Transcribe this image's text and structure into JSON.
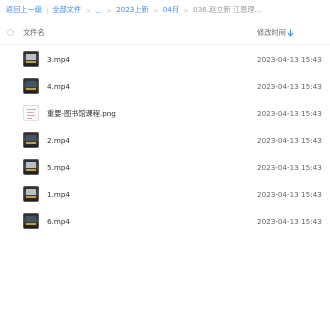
{
  "breadcrumb": {
    "items": [
      {
        "label": "返回上一级",
        "type": "link"
      },
      {
        "label": "全部文件",
        "type": "link"
      },
      {
        "label": "...",
        "type": "link"
      },
      {
        "label": "2023上新",
        "type": "link"
      },
      {
        "label": "04月",
        "type": "link"
      },
      {
        "label": "036.赵立新 江恩理...",
        "type": "current"
      }
    ],
    "separator": "|"
  },
  "header": {
    "name_label": "文件名",
    "time_label": "修改时间",
    "sort_icon": "sort-descending-icon"
  },
  "colors": {
    "accent": "#3b8ff5",
    "text": "#333333",
    "muted": "#666666"
  },
  "files": [
    {
      "name": "3.mp4",
      "time": "2023-04-13 15:43",
      "kind": "video",
      "icon": "video-thumbnail"
    },
    {
      "name": "4.mp4",
      "time": "2023-04-13 15:43",
      "kind": "video",
      "icon": "video-thumbnail"
    },
    {
      "name": "重要-图书馆课程.png",
      "time": "2023-04-13 15:43",
      "kind": "image",
      "icon": "image-thumbnail"
    },
    {
      "name": "2.mp4",
      "time": "2023-04-13 15:43",
      "kind": "video",
      "icon": "video-thumbnail"
    },
    {
      "name": "5.mp4",
      "time": "2023-04-13 15:43",
      "kind": "video",
      "icon": "video-thumbnail"
    },
    {
      "name": "1.mp4",
      "time": "2023-04-13 15:43",
      "kind": "video",
      "icon": "video-thumbnail"
    },
    {
      "name": "6.mp4",
      "time": "2023-04-13 15:43",
      "kind": "video",
      "icon": "video-thumbnail"
    }
  ]
}
